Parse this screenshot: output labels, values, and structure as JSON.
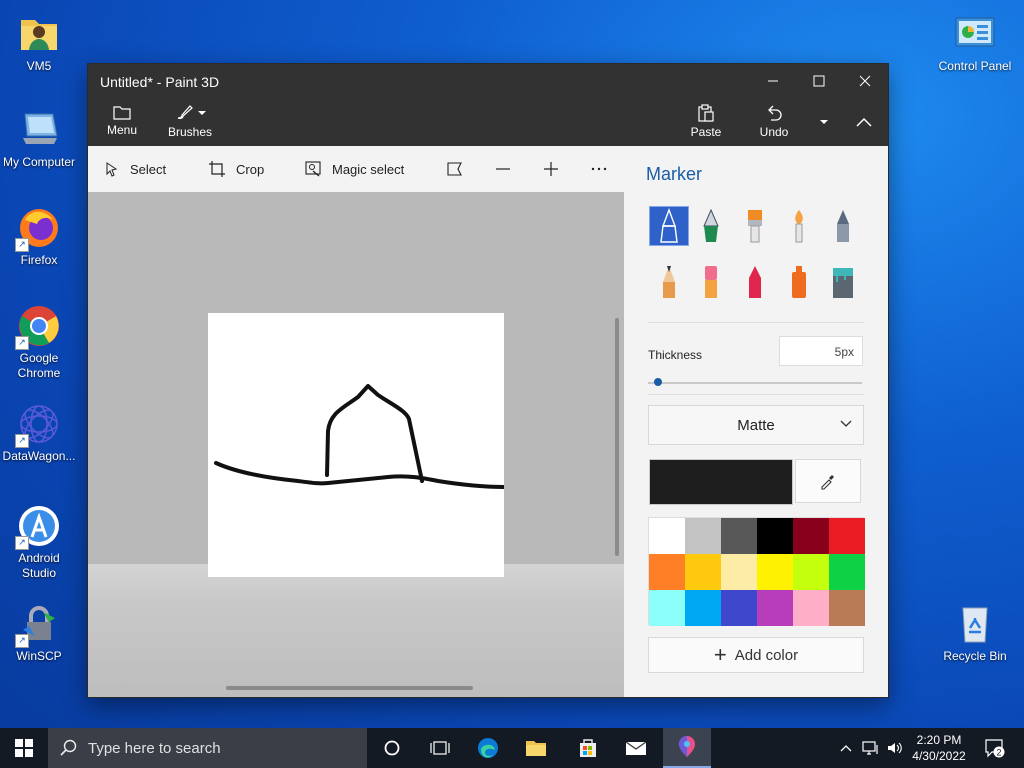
{
  "desktop": {
    "icons": [
      {
        "label": "VM5"
      },
      {
        "label": "My Computer"
      },
      {
        "label": "Firefox"
      },
      {
        "label": "Google Chrome"
      },
      {
        "label": "DataWagon..."
      },
      {
        "label": "Android Studio"
      },
      {
        "label": "WinSCP"
      },
      {
        "label": "Control Panel"
      },
      {
        "label": "Recycle Bin"
      }
    ]
  },
  "window": {
    "title": "Untitled* - Paint 3D",
    "controls": {
      "minimize": "minimize-icon",
      "maximize": "maximize-icon",
      "close": "close-icon"
    }
  },
  "ribbon": {
    "menu_label": "Menu",
    "brushes_label": "Brushes",
    "paste_label": "Paste",
    "undo_label": "Undo"
  },
  "toolbar": {
    "select_label": "Select",
    "crop_label": "Crop",
    "magic_select_label": "Magic select"
  },
  "panel": {
    "title": "Marker",
    "brushes": [
      {
        "name": "marker",
        "color": "#2f62c9",
        "selected": true
      },
      {
        "name": "calligraphy-pen",
        "color": "#1f8a50"
      },
      {
        "name": "oil-brush",
        "color": "#f08a24"
      },
      {
        "name": "watercolor",
        "color": "#f4a340"
      },
      {
        "name": "pixel-pen",
        "color": "#5a6a82"
      },
      {
        "name": "pencil",
        "color": "#e89a4c"
      },
      {
        "name": "eraser",
        "color": "#f06d8e"
      },
      {
        "name": "crayon",
        "color": "#e0264c"
      },
      {
        "name": "spray-can",
        "color": "#ef6b1e"
      },
      {
        "name": "fill-bucket",
        "color": "#3fb6b8"
      }
    ],
    "thickness_label": "Thickness",
    "thickness_value": "5px",
    "thickness_level": 0.03,
    "finish_value": "Matte",
    "current_color": "#1e1e1e",
    "palette": [
      "#ffffff",
      "#c3c3c3",
      "#585858",
      "#000000",
      "#88001b",
      "#ec1c24",
      "#ff7f27",
      "#ffc90e",
      "#fdeca6",
      "#fff200",
      "#c4ff0e",
      "#0ed145",
      "#8cfffb",
      "#00a8f3",
      "#3f48cc",
      "#b83dba",
      "#ffaec8",
      "#b97a56"
    ],
    "add_color_label": "Add color"
  },
  "taskbar": {
    "search_placeholder": "Type here to search",
    "time": "2:20 PM",
    "date": "4/30/2022",
    "notifications": "2"
  }
}
